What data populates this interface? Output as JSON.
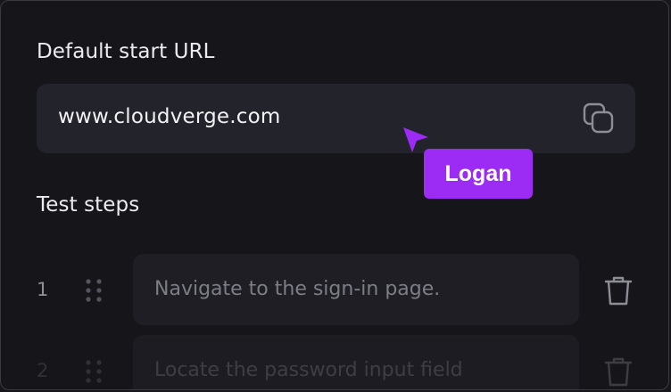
{
  "start_url": {
    "label": "Default start URL",
    "value": "www.cloudverge.com",
    "copy_icon": "copy-icon"
  },
  "collaborator": {
    "name": "Logan",
    "color": "#9c2cf3",
    "cursor_icon": "cursor-arrow-icon"
  },
  "test_steps": {
    "label": "Test steps",
    "items": [
      {
        "number": "1",
        "text": "Navigate to the sign-in page."
      },
      {
        "number": "2",
        "text": "Locate the password input field"
      }
    ]
  }
}
